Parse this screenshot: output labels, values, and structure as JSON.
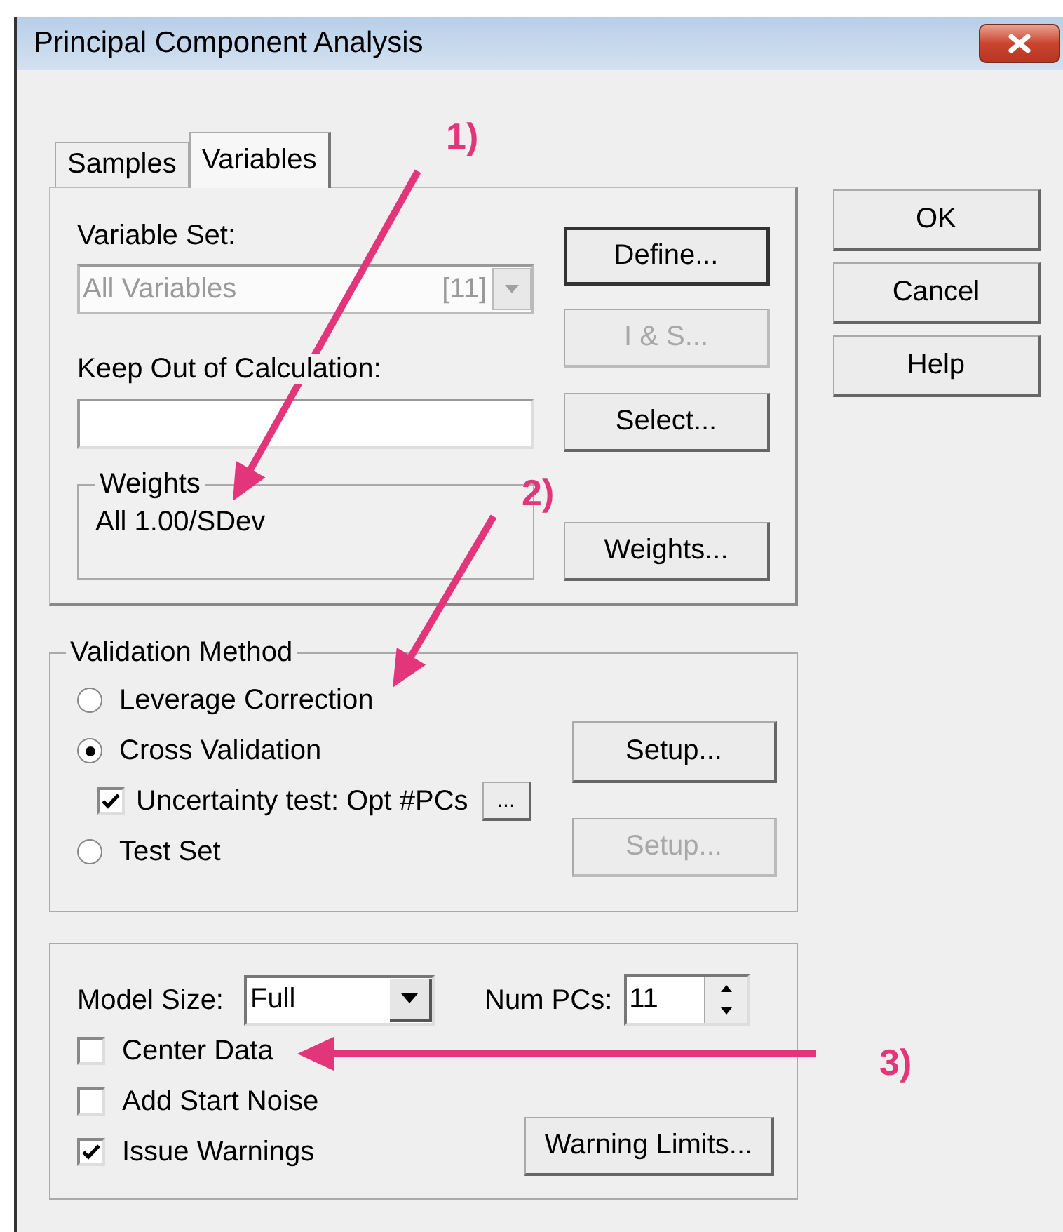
{
  "window": {
    "title": "Principal Component Analysis"
  },
  "tabs": [
    {
      "label": "Samples",
      "selected": false
    },
    {
      "label": "Variables",
      "selected": true
    }
  ],
  "variable_set": {
    "label": "Variable Set:",
    "value": "All Variables",
    "count": "[11]",
    "disabled": true
  },
  "keep_out": {
    "label": "Keep Out of Calculation:"
  },
  "weights": {
    "title": "Weights",
    "value": "All 1.00/SDev"
  },
  "pane_buttons": [
    {
      "label": "Define...",
      "disabled": false
    },
    {
      "label": "I & S...",
      "disabled": true
    },
    {
      "label": "Select...",
      "disabled": false
    },
    {
      "label": "Weights...",
      "disabled": false
    }
  ],
  "validation": {
    "title": "Validation Method",
    "options": [
      {
        "label": "Leverage Correction",
        "selected": false
      },
      {
        "label": "Cross Validation",
        "selected": true
      },
      {
        "label": "Test Set",
        "selected": false
      }
    ],
    "uncertainty": {
      "label": "Uncertainty test: Opt #PCs",
      "checked": true,
      "button": "..."
    },
    "setup_buttons": [
      {
        "label": "Setup...",
        "disabled": false
      },
      {
        "label": "Setup...",
        "disabled": true
      }
    ]
  },
  "model": {
    "model_size_label": "Model Size:",
    "model_size": "Full",
    "num_pcs_label": "Num PCs:",
    "num_pcs": "11",
    "options": [
      {
        "label": "Center Data",
        "checked": false
      },
      {
        "label": "Add Start Noise",
        "checked": false
      },
      {
        "label": "Issue Warnings",
        "checked": true
      }
    ],
    "warning_button": "Warning Limits..."
  },
  "dialog_buttons": [
    "OK",
    "Cancel",
    "Help"
  ],
  "annotations": [
    {
      "label": "1)"
    },
    {
      "label": "2)"
    },
    {
      "label": "3)"
    }
  ]
}
